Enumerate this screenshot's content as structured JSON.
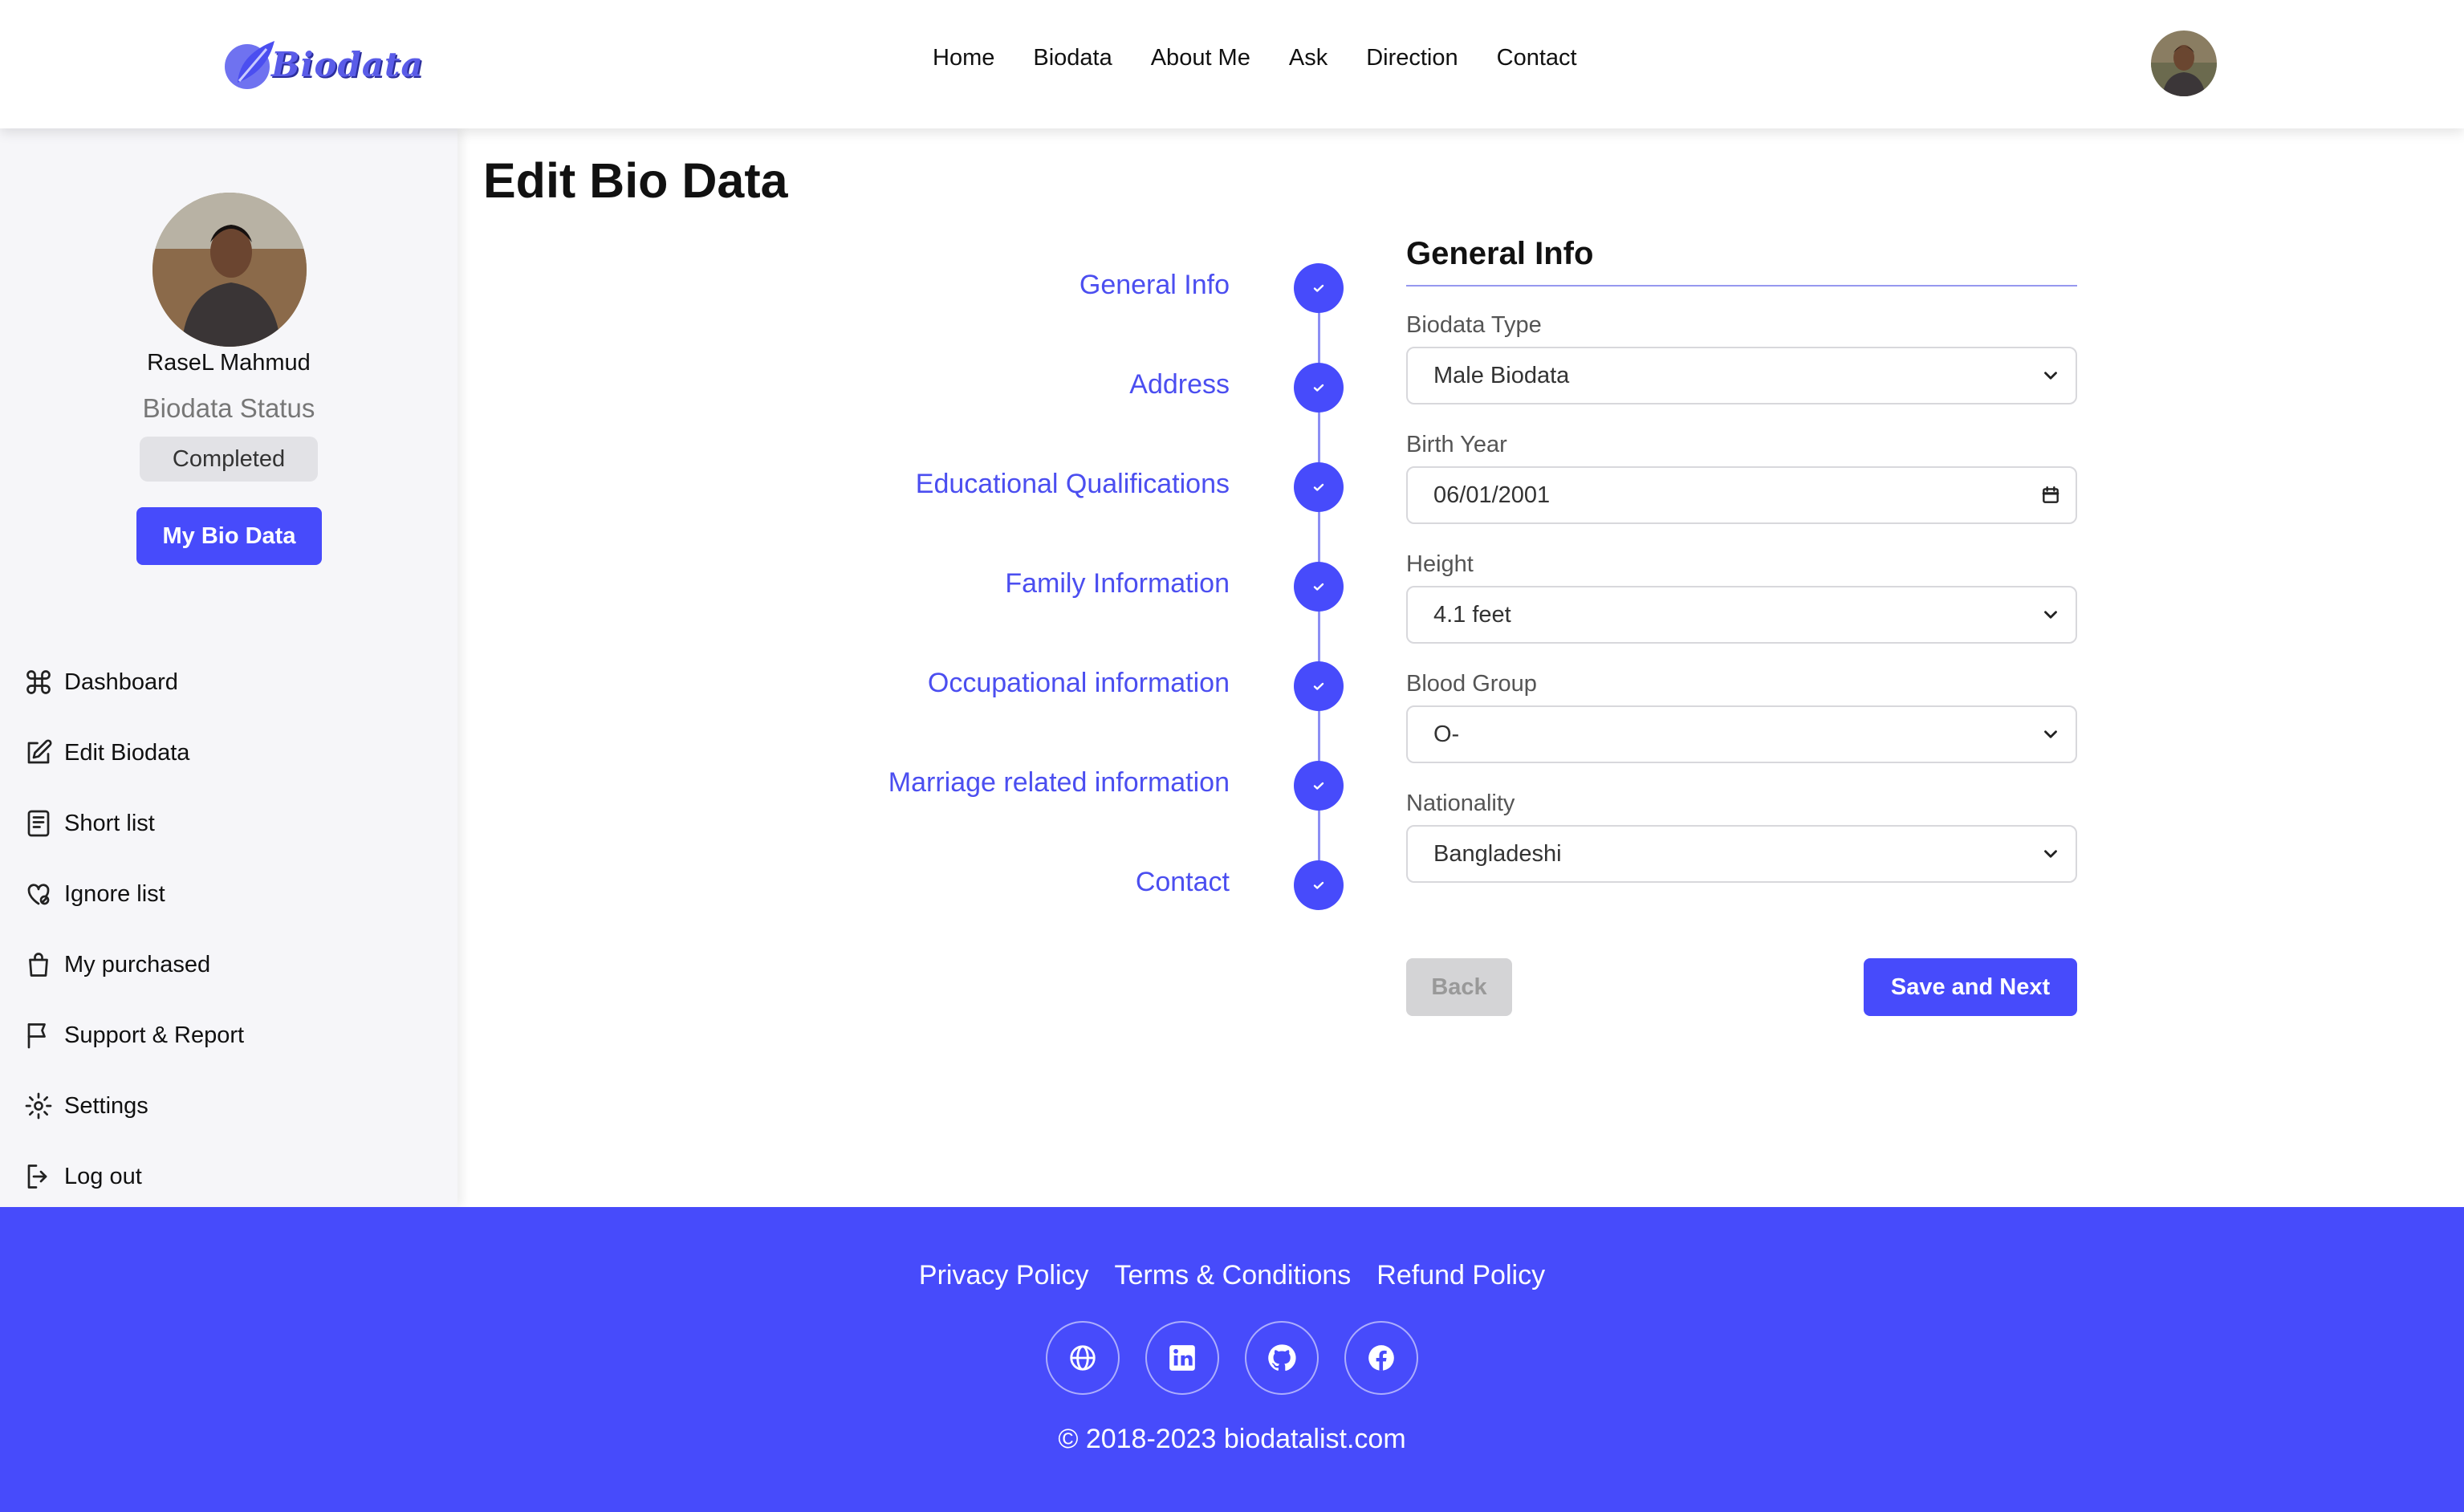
{
  "header": {
    "logo_text": "Biodata",
    "nav": [
      "Home",
      "Biodata",
      "About Me",
      "Ask",
      "Direction",
      "Contact"
    ]
  },
  "sidebar": {
    "name": "RaseL Mahmud",
    "status_label": "Biodata Status",
    "status_value": "Completed",
    "button_label": "My Bio Data",
    "menu": [
      {
        "label": "Dashboard",
        "icon": "command-icon"
      },
      {
        "label": "Edit Biodata",
        "icon": "edit-icon"
      },
      {
        "label": "Short list",
        "icon": "list-icon"
      },
      {
        "label": "Ignore list",
        "icon": "heart-off-icon"
      },
      {
        "label": "My purchased",
        "icon": "bag-icon"
      },
      {
        "label": "Support & Report",
        "icon": "flag-icon"
      },
      {
        "label": "Settings",
        "icon": "gear-icon"
      },
      {
        "label": "Log out",
        "icon": "logout-icon"
      }
    ]
  },
  "main": {
    "title": "Edit Bio Data",
    "steps": [
      "General Info",
      "Address",
      "Educational Qualifications",
      "Family Information",
      "Occupational information",
      "Marriage related information",
      "Contact"
    ],
    "form": {
      "title": "General Info",
      "fields": [
        {
          "label": "Biodata Type",
          "value": "Male Biodata",
          "type": "select"
        },
        {
          "label": "Birth Year",
          "value": "06/01/2001",
          "type": "date"
        },
        {
          "label": "Height",
          "value": "4.1 feet",
          "type": "select"
        },
        {
          "label": "Blood Group",
          "value": "O-",
          "type": "select"
        },
        {
          "label": "Nationality",
          "value": "Bangladeshi",
          "type": "select"
        }
      ],
      "back_label": "Back",
      "next_label": "Save and Next"
    }
  },
  "footer": {
    "links": [
      "Privacy Policy",
      "Terms & Conditions",
      "Refund Policy"
    ],
    "social": [
      "globe-icon",
      "linkedin-icon",
      "github-icon",
      "facebook-icon"
    ],
    "copyright": "© 2018-2023 biodatalist.com"
  },
  "colors": {
    "accent": "#474bfb",
    "step_text": "#4b4ef0",
    "sidebar_bg": "#f6f6f9"
  }
}
